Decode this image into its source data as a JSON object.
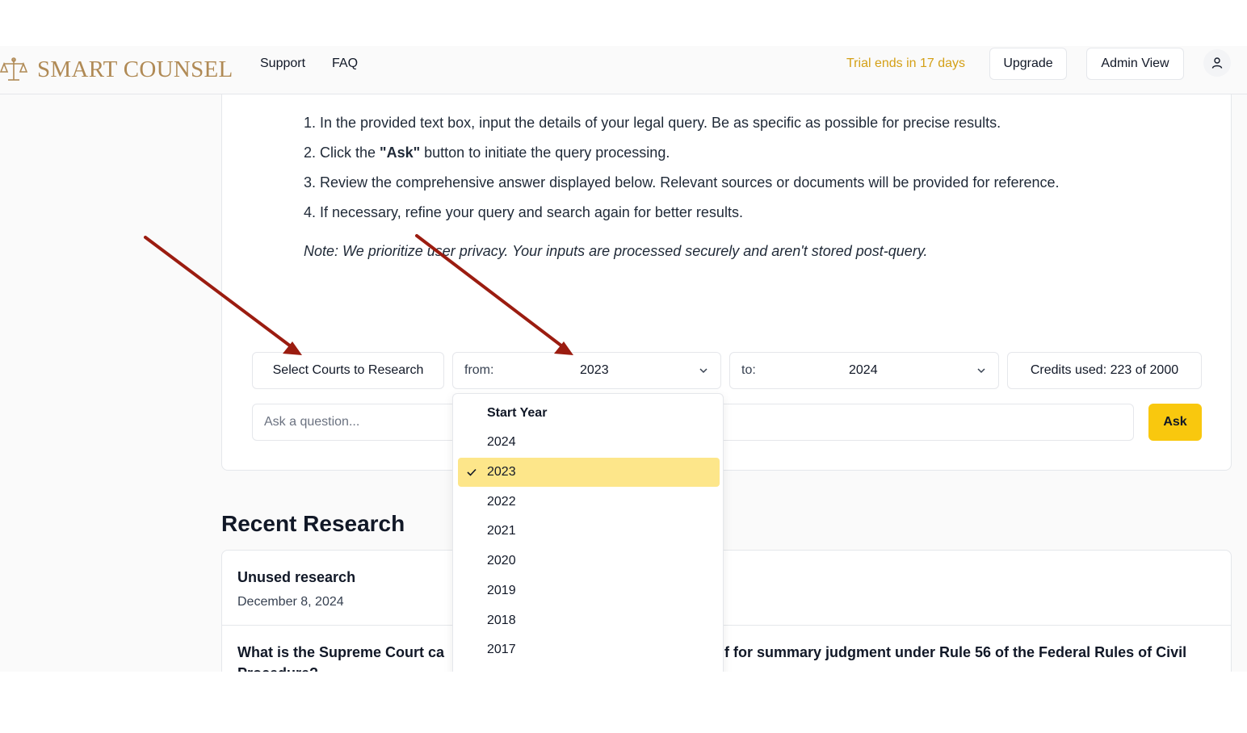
{
  "brand": {
    "name": "SMART COUNSEL",
    "icon": "scales-of-justice-icon",
    "color": "#b08a55"
  },
  "nav": {
    "support": "Support",
    "faq": "FAQ"
  },
  "header": {
    "trial": "Trial ends in 17 days",
    "upgrade": "Upgrade",
    "admin_view": "Admin View",
    "user_icon": "user-icon"
  },
  "instructions": {
    "step1": "1. In the provided text box, input the details of your legal query. Be as specific as possible for precise results.",
    "step2_prefix": "2. Click the ",
    "step2_bold": "\"Ask\"",
    "step2_suffix": " button to initiate the query processing.",
    "step3": "3. Review the comprehensive answer displayed below. Relevant sources or documents will be provided for reference.",
    "step4": "4. If necessary, refine your query and search again for better results.",
    "note": "Note: We prioritize user privacy. Your inputs are processed securely and aren't stored post-query."
  },
  "controls": {
    "select_courts": "Select Courts to Research",
    "from_label": "from:",
    "from_value": "2023",
    "to_label": "to:",
    "to_value": "2024",
    "credits": "Credits used: 223 of 2000"
  },
  "ask": {
    "placeholder": "Ask a question...",
    "button": "Ask",
    "button_color": "#f9c80e"
  },
  "dropdown": {
    "header": "Start Year",
    "selected": "2023",
    "selected_color": "#fde68a",
    "options": [
      "2024",
      "2023",
      "2022",
      "2021",
      "2020",
      "2019",
      "2018",
      "2017"
    ]
  },
  "recent": {
    "title": "Recent Research",
    "items": [
      {
        "title": "Unused research",
        "date": "December 8, 2024"
      },
      {
        "title_start": "What is the Supreme Court ca",
        "title_end": "f for summary judgment under Rule 56 of the Federal Rules of Civil",
        "title_wrap": "Procedure?"
      }
    ]
  },
  "annotation": {
    "arrow_color": "#9b1c10"
  }
}
